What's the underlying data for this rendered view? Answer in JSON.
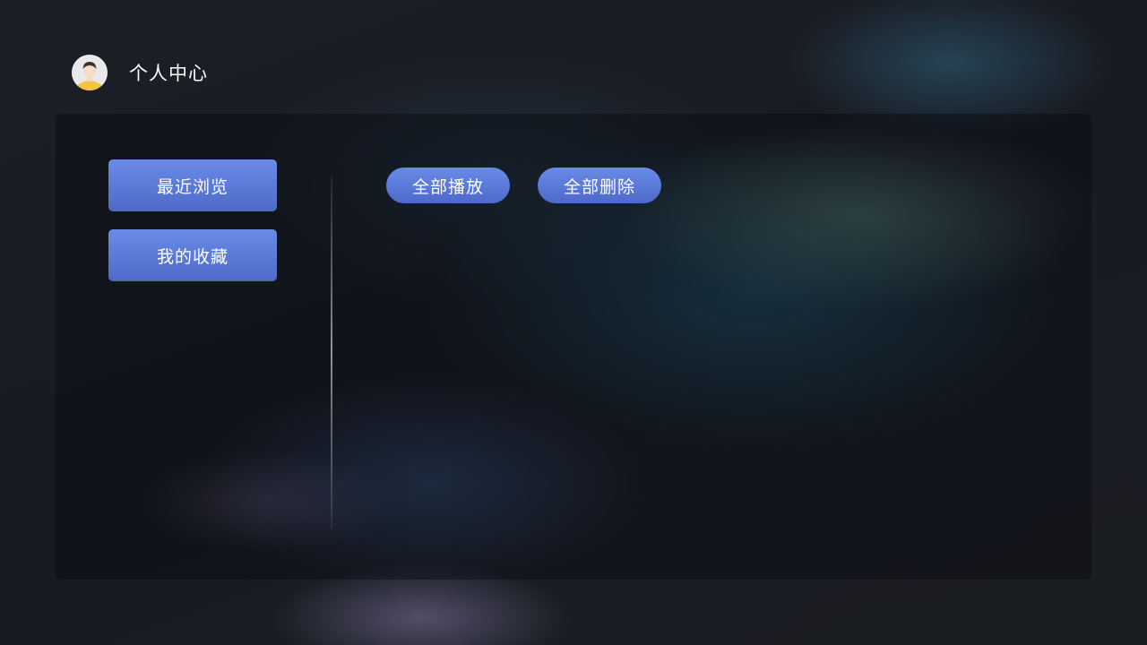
{
  "header": {
    "title": "个人中心",
    "avatar_icon": "user-avatar-icon"
  },
  "sidebar": {
    "items": [
      {
        "label": "最近浏览"
      },
      {
        "label": "我的收藏"
      }
    ]
  },
  "actions": {
    "play_all_label": "全部播放",
    "delete_all_label": "全部删除"
  },
  "colors": {
    "button_top": "#6a8be8",
    "button_bottom": "#4e6ac8",
    "text": "#ffffff"
  }
}
